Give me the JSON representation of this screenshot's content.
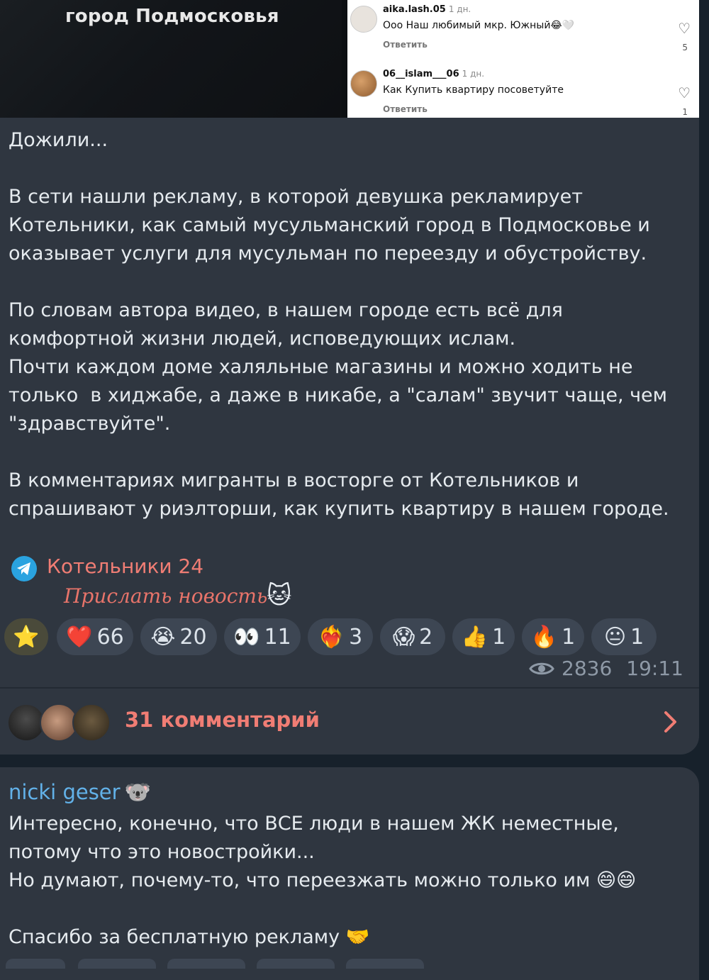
{
  "media": {
    "video_caption": "город Подмосковья",
    "comments": [
      {
        "user": "aika.lash.05",
        "age": "1 дн.",
        "text": "Ооо Наш любимый мкр. Южный😂🤍",
        "reply": "Ответить",
        "likes": "5"
      },
      {
        "user": "06__islam___06",
        "age": "1 дн.",
        "text": "Как Купить квартиру посоветуйте",
        "reply": "Ответить",
        "likes": "1"
      }
    ]
  },
  "post": {
    "paragraphs": [
      "Дожили...",
      "",
      "В сети нашли рекламу, в которой девушка рекламирует Котельники, как самый мусульманский город в Подмосковье и оказывает услуги для мусульман по переезду и обустройству.",
      "",
      "По словам автора видео, в нашем городе есть всё для комфортной жизни людей, исповедующих ислам.",
      "Почти каждом доме халяльные магазины и можно ходить не только  в хиджабе, а даже в никабе, а \"салам\" звучит чаще, чем \"здравствуйте\".",
      "",
      "В комментариях мигранты в восторге от Котельников и спрашивают у риэлторши, как купить квартиру в нашем городе."
    ],
    "channel_name": "Котельники 24",
    "send_news": "Прислать новость",
    "reactions": [
      {
        "emoji": "⭐",
        "count": ""
      },
      {
        "emoji": "❤️",
        "count": "66"
      },
      {
        "emoji": "😭",
        "count": "20"
      },
      {
        "emoji": "👀",
        "count": "11"
      },
      {
        "emoji": "❤️‍🔥",
        "count": "3"
      },
      {
        "emoji": "😱",
        "count": "2"
      },
      {
        "emoji": "👍",
        "count": "1"
      },
      {
        "emoji": "🔥",
        "count": "1"
      },
      {
        "emoji": "😐",
        "count": "1"
      }
    ],
    "views": "2836",
    "time": "19:11",
    "comments_label": "31 комментарий"
  },
  "reply": {
    "author": "nicki geser",
    "author_emoji": "🐨",
    "lines": [
      "Интересно, конечно, что ВСЕ люди в нашем ЖК неместные, потому что это новостройки...",
      "Но думают, почему-то, что переезжать можно только им 😄😄",
      "",
      "Спасибо за бесплатную рекламу 🤝"
    ]
  },
  "colors": {
    "accent": "#f07d74",
    "author": "#62b1e8",
    "bubble": "#2f3640",
    "background": "#17212b"
  }
}
